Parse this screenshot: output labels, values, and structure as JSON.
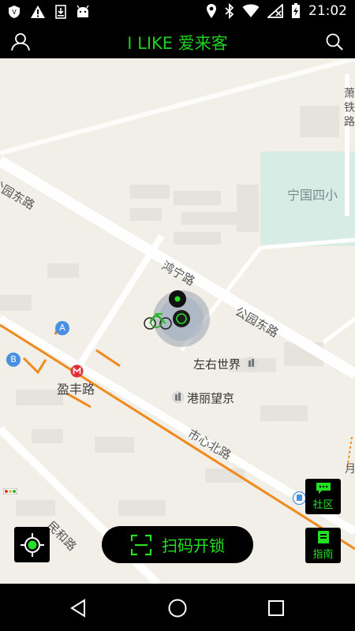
{
  "status_bar": {
    "time": "21:02",
    "left_icons": [
      "vpn-shield-icon",
      "warning-icon",
      "download-icon",
      "android-icon"
    ],
    "right_icons": [
      "location-pin-icon",
      "bluetooth-icon",
      "wifi-icon",
      "no-sim-icon",
      "battery-charging-icon"
    ]
  },
  "app_bar": {
    "title": "I LIKE 爱来客",
    "left_icon": "user-profile-icon",
    "right_icon": "search-icon"
  },
  "map": {
    "labels": {
      "gongyuan_road_nw": "公园东路",
      "hongning_road": "鸿宁路",
      "gongyuan_road_se": "公园东路",
      "ningguo_school": "宁国四小",
      "zuoyou_world": "左右世界",
      "gangli_wangjing": "港丽望京",
      "yingfeng_road": "盈丰路",
      "shixin_north_road": "市心北路",
      "minhe_road": "民和路",
      "xiao_char": "萧",
      "jin_char": "铁",
      "lu_char": "路",
      "yue_char": "月",
      "pin_a": "A",
      "pin_b": "B"
    }
  },
  "buttons": {
    "scan_unlock": "扫码开锁",
    "community": "社区",
    "guide": "指南"
  },
  "colors": {
    "accent_green": "#22e022",
    "map_bg": "#f1efe8",
    "road_orange": "#f08a1c",
    "metro_red": "#e0303a",
    "pin_blue": "#4a90e2"
  }
}
